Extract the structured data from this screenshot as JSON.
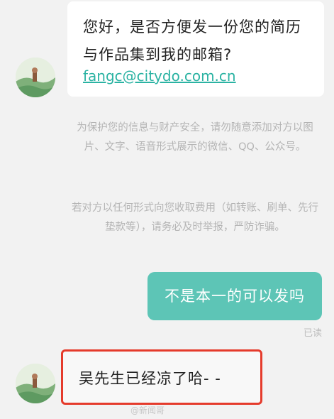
{
  "messages": [
    {
      "direction": "incoming",
      "lines": [
        "您好，是否方便发一份您的简历",
        "与作品集到我的邮箱?"
      ],
      "email": "fangc@citydo.com.cn"
    },
    {
      "direction": "outgoing",
      "text": "不是本一的可以发吗",
      "status": "已读"
    },
    {
      "direction": "incoming",
      "text": "吴先生已经凉了哈- -"
    }
  ],
  "notices": [
    "为保护您的信息与财产安全，请勿随意添加对方以图片、文字、语音形式展示的微信、QQ、公众号。",
    "若对方以任何形式向您收取费用（如转账、刷单、先行垫款等），请务必及时举报，严防诈骗。"
  ],
  "watermark": "@新闻哥",
  "colors": {
    "outgoing_bubble": "#5dc5b6",
    "link": "#2bb3a3",
    "highlight_box": "#e53b2c",
    "notice_text": "#b4b4b4"
  }
}
